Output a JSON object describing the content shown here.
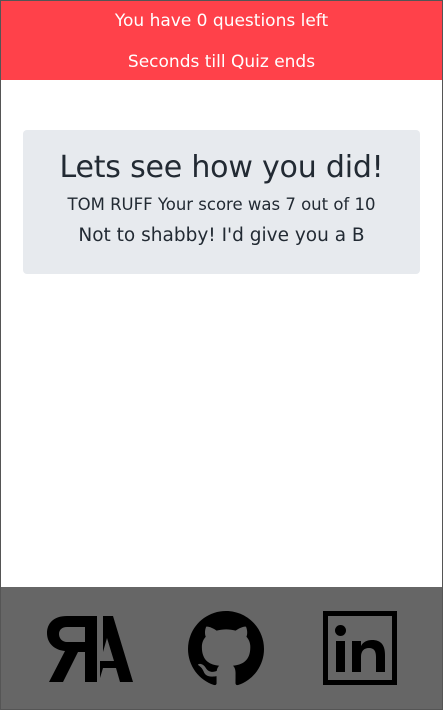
{
  "header": {
    "questions_left": "You have 0 questions left",
    "timer_text": "Seconds till Quiz ends"
  },
  "result": {
    "title": "Lets see how you did!",
    "score_text": "TOM RUFF Your score was 7 out of 10",
    "grade_text": "Not to shabby! I'd give you a B"
  },
  "footer": {
    "links": [
      {
        "icon": "portfolio-logo-icon"
      },
      {
        "icon": "github-icon"
      },
      {
        "icon": "linkedin-icon"
      }
    ]
  },
  "colors": {
    "header_bg": "#ff414a",
    "footer_bg": "#666666",
    "card_bg": "#e7eaee",
    "text_dark": "#222a33"
  }
}
